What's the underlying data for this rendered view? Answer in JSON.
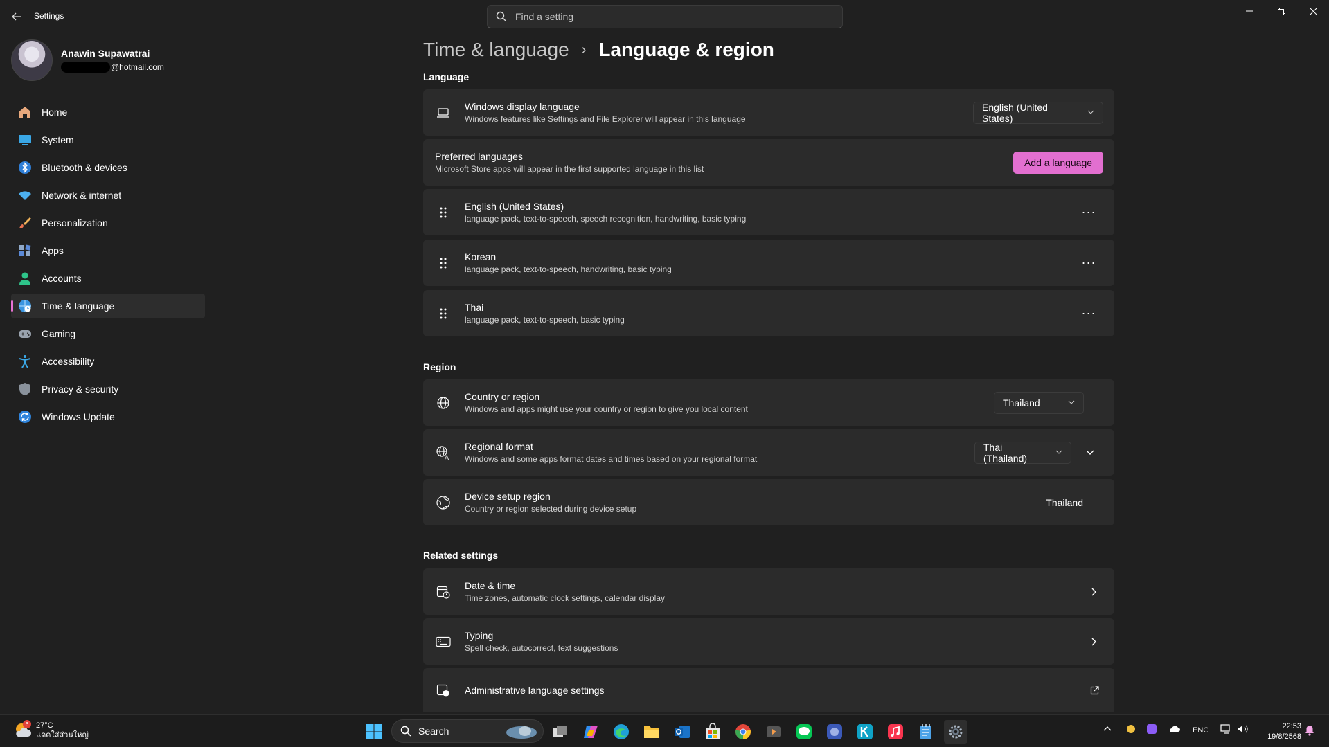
{
  "window": {
    "title": "Settings",
    "search_placeholder": "Find a setting"
  },
  "profile": {
    "name": "Anawin Supawatrai",
    "email_suffix": "@hotmail.com"
  },
  "sidebar": {
    "items": [
      {
        "label": "Home",
        "icon": "home-icon"
      },
      {
        "label": "System",
        "icon": "system-icon"
      },
      {
        "label": "Bluetooth & devices",
        "icon": "bluetooth-icon"
      },
      {
        "label": "Network & internet",
        "icon": "wifi-icon"
      },
      {
        "label": "Personalization",
        "icon": "brush-icon"
      },
      {
        "label": "Apps",
        "icon": "apps-icon"
      },
      {
        "label": "Accounts",
        "icon": "accounts-icon"
      },
      {
        "label": "Time & language",
        "icon": "globe-clock-icon",
        "active": true
      },
      {
        "label": "Gaming",
        "icon": "gamepad-icon"
      },
      {
        "label": "Accessibility",
        "icon": "accessibility-icon"
      },
      {
        "label": "Privacy & security",
        "icon": "shield-icon"
      },
      {
        "label": "Windows Update",
        "icon": "update-icon"
      }
    ]
  },
  "breadcrumb": {
    "parent": "Time & language",
    "separator": "›",
    "current": "Language & region"
  },
  "language": {
    "section_title": "Language",
    "display_language": {
      "title": "Windows display language",
      "subtitle": "Windows features like Settings and File Explorer will appear in this language",
      "value": "English (United States)"
    },
    "preferred": {
      "title": "Preferred languages",
      "subtitle": "Microsoft Store apps will appear in the first supported language in this list",
      "button": "Add a language"
    },
    "items": [
      {
        "title": "English (United States)",
        "subtitle": "language pack, text-to-speech, speech recognition, handwriting, basic typing"
      },
      {
        "title": "Korean",
        "subtitle": "language pack, text-to-speech, handwriting, basic typing"
      },
      {
        "title": "Thai",
        "subtitle": "language pack, text-to-speech, basic typing"
      }
    ],
    "more_label": "···"
  },
  "region": {
    "section_title": "Region",
    "country": {
      "title": "Country or region",
      "subtitle": "Windows and apps might use your country or region to give you local content",
      "value": "Thailand"
    },
    "format": {
      "title": "Regional format",
      "subtitle": "Windows and some apps format dates and times based on your regional format",
      "value": "Thai (Thailand)"
    },
    "device": {
      "title": "Device setup region",
      "subtitle": "Country or region selected during device setup",
      "value": "Thailand"
    }
  },
  "related": {
    "section_title": "Related settings",
    "items": [
      {
        "title": "Date & time",
        "subtitle": "Time zones, automatic clock settings, calendar display"
      },
      {
        "title": "Typing",
        "subtitle": "Spell check, autocorrect, text suggestions"
      },
      {
        "title": "Administrative language settings",
        "subtitle": ""
      }
    ]
  },
  "taskbar": {
    "weather_temp": "27°C",
    "weather_desc": "แดดใส่ส่วนใหญ่",
    "weather_badge": "6",
    "search_label": "Search",
    "lang": "ENG",
    "time": "22:53",
    "date": "19/8/2568"
  },
  "colors": {
    "accent": "#e26fd0",
    "background": "#202020",
    "card": "#2b2b2b"
  }
}
